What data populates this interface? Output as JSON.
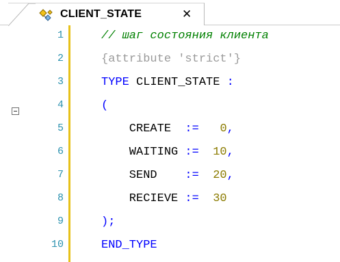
{
  "tab": {
    "title": "CLIENT_STATE",
    "close_glyph": "✕",
    "icon": "data-type-icon"
  },
  "colors": {
    "comment": "#008000",
    "keyword": "#0000ff",
    "pragma": "#9a9a9a",
    "number": "#8b7b00",
    "line_number": "#2b91af",
    "gutter_bar": "#e7c11a"
  },
  "editor": {
    "lines": [
      {
        "num": "1",
        "tokens": [
          {
            "t": "// шаг состояния клиента",
            "k": "comment"
          }
        ]
      },
      {
        "num": "2",
        "tokens": [
          {
            "t": "{attribute 'strict'}",
            "k": "pragma"
          }
        ]
      },
      {
        "num": "3",
        "tokens": [
          {
            "t": "TYPE",
            "k": "keyword"
          },
          {
            "t": " CLIENT_STATE ",
            "k": "ident"
          },
          {
            "t": ":",
            "k": "punct"
          }
        ]
      },
      {
        "num": "4",
        "tokens": [
          {
            "t": "(",
            "k": "punct"
          }
        ]
      },
      {
        "num": "5",
        "tokens": [
          {
            "t": "    CREATE  ",
            "k": "ident"
          },
          {
            "t": ":=",
            "k": "op"
          },
          {
            "t": "   ",
            "k": "ident"
          },
          {
            "t": "0",
            "k": "num"
          },
          {
            "t": ",",
            "k": "punct"
          }
        ]
      },
      {
        "num": "6",
        "tokens": [
          {
            "t": "    WAITING ",
            "k": "ident"
          },
          {
            "t": ":=",
            "k": "op"
          },
          {
            "t": "  ",
            "k": "ident"
          },
          {
            "t": "10",
            "k": "num"
          },
          {
            "t": ",",
            "k": "punct"
          }
        ]
      },
      {
        "num": "7",
        "tokens": [
          {
            "t": "    SEND    ",
            "k": "ident"
          },
          {
            "t": ":=",
            "k": "op"
          },
          {
            "t": "  ",
            "k": "ident"
          },
          {
            "t": "20",
            "k": "num"
          },
          {
            "t": ",",
            "k": "punct"
          }
        ]
      },
      {
        "num": "8",
        "tokens": [
          {
            "t": "    RECIEVE ",
            "k": "ident"
          },
          {
            "t": ":=",
            "k": "op"
          },
          {
            "t": "  ",
            "k": "ident"
          },
          {
            "t": "30",
            "k": "num"
          }
        ]
      },
      {
        "num": "9",
        "tokens": [
          {
            "t": ");",
            "k": "punct"
          }
        ]
      },
      {
        "num": "10",
        "tokens": [
          {
            "t": "END_TYPE",
            "k": "keyword"
          }
        ]
      }
    ],
    "folded_line": "4"
  }
}
